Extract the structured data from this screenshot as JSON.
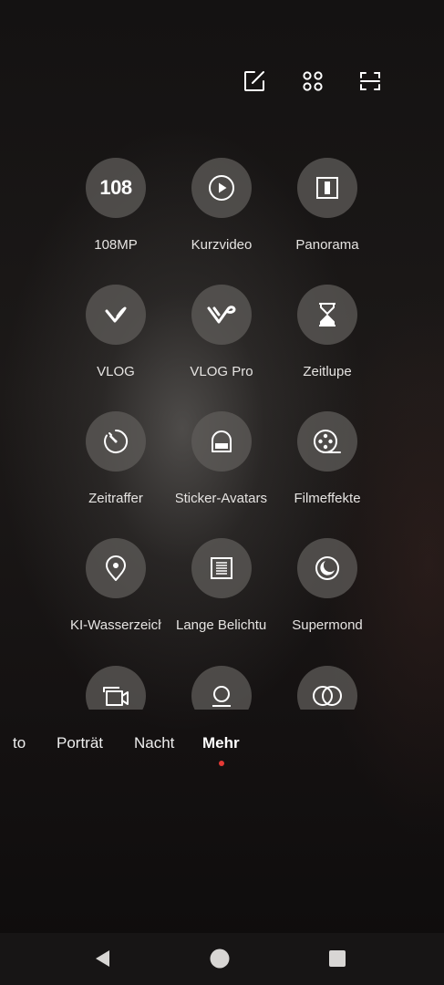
{
  "top_toolbar": {
    "icons": [
      "edit-icon",
      "grid-icon",
      "scan-icon"
    ]
  },
  "modes": [
    {
      "label": "108MP",
      "icon": "108-icon",
      "icon_text": "108"
    },
    {
      "label": "Kurzvideo",
      "icon": "play-icon"
    },
    {
      "label": "Panorama",
      "icon": "panorama-icon"
    },
    {
      "label": "VLOG",
      "icon": "vlog-icon"
    },
    {
      "label": "VLOG Pro",
      "icon": "vlog-pro-icon"
    },
    {
      "label": "Zeitlupe",
      "icon": "hourglass-icon"
    },
    {
      "label": "Zeitraffer",
      "icon": "timelapse-icon"
    },
    {
      "label": "Sticker-Avatars",
      "icon": "sticker-avatar-icon"
    },
    {
      "label": "Filmeffekte",
      "icon": "film-reel-icon"
    },
    {
      "label": "KI-Wasserzeichen",
      "icon": "location-pin-icon"
    },
    {
      "label": "Lange Belichtung",
      "icon": "long-exposure-icon"
    },
    {
      "label": "Supermond",
      "icon": "moon-icon"
    },
    {
      "label": "",
      "icon": "dual-video-icon"
    },
    {
      "label": "",
      "icon": "portrait-person-icon"
    },
    {
      "label": "",
      "icon": "overlap-circles-icon"
    }
  ],
  "mode_tabs": [
    {
      "label": "Foto",
      "visible_text": "to"
    },
    {
      "label": "Porträt",
      "visible_text": "Porträt"
    },
    {
      "label": "Nacht",
      "visible_text": "Nacht"
    },
    {
      "label": "Mehr",
      "visible_text": "Mehr",
      "active": true
    }
  ],
  "navigation_bar": {
    "icons": [
      "back-icon",
      "home-icon",
      "recents-icon"
    ]
  },
  "colors": {
    "active_indicator": "#e53935",
    "circle_bg": "#5f5c5a",
    "text": "#e6e4e2"
  }
}
